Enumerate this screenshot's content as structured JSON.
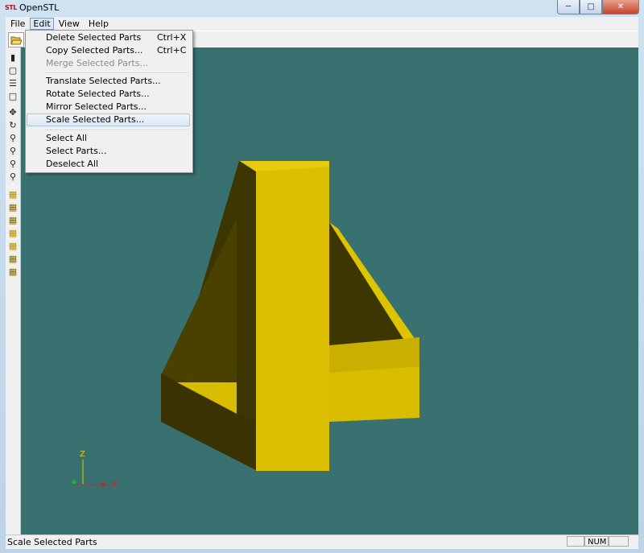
{
  "window": {
    "app_badge": "STL",
    "title": "OpenSTL"
  },
  "menubar": {
    "items": [
      "File",
      "Edit",
      "View",
      "Help"
    ]
  },
  "edit_menu": {
    "items": [
      {
        "label": "Delete Selected Parts",
        "shortcut": "Ctrl+X",
        "enabled": true
      },
      {
        "label": "Copy Selected Parts...",
        "shortcut": "Ctrl+C",
        "enabled": true
      },
      {
        "label": "Merge Selected Parts...",
        "shortcut": "",
        "enabled": false
      },
      {
        "label": "Translate Selected Parts...",
        "shortcut": "",
        "enabled": true
      },
      {
        "label": "Rotate Selected Parts...",
        "shortcut": "",
        "enabled": true
      },
      {
        "label": "Mirror Selected Parts...",
        "shortcut": "",
        "enabled": true
      },
      {
        "label": "Scale Selected Parts...",
        "shortcut": "",
        "enabled": true,
        "highlighted": true
      },
      {
        "label": "Select All",
        "shortcut": "",
        "enabled": true
      },
      {
        "label": "Select Parts...",
        "shortcut": "",
        "enabled": true
      },
      {
        "label": "Deselect All",
        "shortcut": "",
        "enabled": true
      }
    ]
  },
  "axes": {
    "z_label": "Z",
    "x_label": "X"
  },
  "statusbar": {
    "text": "Scale Selected Parts",
    "num": "NUM"
  },
  "colors": {
    "viewport_bg": "#387170",
    "model_yellow": "#dcbf00",
    "model_dark": "#3e3600"
  },
  "icons": {
    "open": "folder-open-icon",
    "left_toolbar": [
      "view-solid-icon",
      "view-wireframe-icon",
      "view-layers-icon",
      "view-box-icon",
      "pan-icon",
      "rotate-icon",
      "zoom-window-icon",
      "zoom-fit-icon",
      "zoom-in-icon",
      "zoom-out-icon",
      "view-front-icon",
      "view-back-icon",
      "view-left-icon",
      "view-right-icon",
      "view-top-icon",
      "view-bottom-icon",
      "view-iso-icon"
    ]
  }
}
